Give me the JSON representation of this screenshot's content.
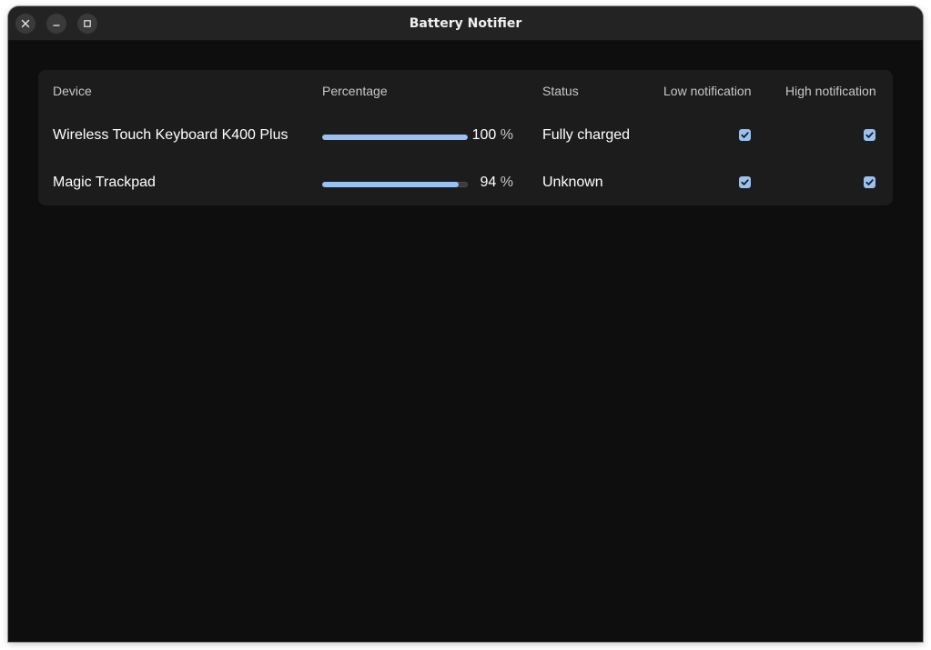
{
  "window": {
    "title": "Battery Notifier",
    "controls": [
      "close-icon",
      "minimize-icon",
      "maximize-icon"
    ]
  },
  "table": {
    "headers": {
      "device": "Device",
      "percentage": "Percentage",
      "status": "Status",
      "low_notification": "Low notification",
      "high_notification": "High notification"
    },
    "rows": [
      {
        "device": "Wireless Touch Keyboard K400 Plus",
        "percentage_value": "100",
        "percentage_unit": "%",
        "battery_level": 1.0,
        "status": "Fully charged",
        "low_notification": true,
        "high_notification": true
      },
      {
        "device": "Magic Trackpad",
        "percentage_value": "94",
        "percentage_unit": "%",
        "battery_level": 0.94,
        "status": "Unknown",
        "low_notification": true,
        "high_notification": true
      }
    ]
  },
  "colors": {
    "accent": "#99c1f1",
    "window_bg": "#0e0e0e",
    "card_bg": "#1c1c1c",
    "titlebar_bg": "#232323"
  }
}
